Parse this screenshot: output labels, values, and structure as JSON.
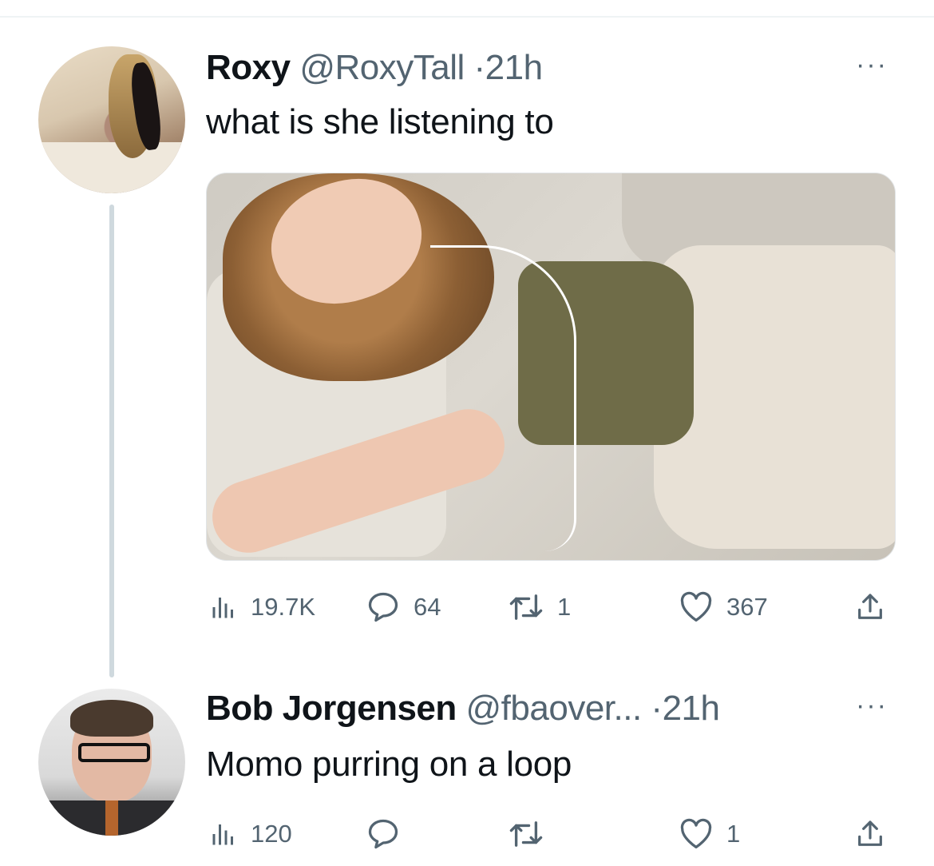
{
  "tweets": [
    {
      "display_name": "Roxy",
      "handle": "@RoxyTall",
      "separator": "·",
      "time": "21h",
      "text": "what is she listening to",
      "more": "···",
      "stats": {
        "views": "19.7K",
        "replies": "64",
        "retweets": "1",
        "likes": "367"
      }
    },
    {
      "display_name": "Bob Jorgensen",
      "handle": "@fbaover...",
      "separator": "·",
      "time": "21h",
      "text": "Momo purring on a loop",
      "more": "···",
      "stats": {
        "views": "120",
        "replies": "",
        "retweets": "",
        "likes": "1"
      }
    }
  ],
  "icons": {
    "views": "bar-chart-icon",
    "reply": "speech-bubble-icon",
    "retweet": "retweet-icon",
    "like": "heart-icon",
    "share": "share-icon",
    "more": "ellipsis-icon"
  },
  "colors": {
    "text": "#0f1419",
    "secondary": "#536471",
    "thread_line": "#cfd9de"
  }
}
